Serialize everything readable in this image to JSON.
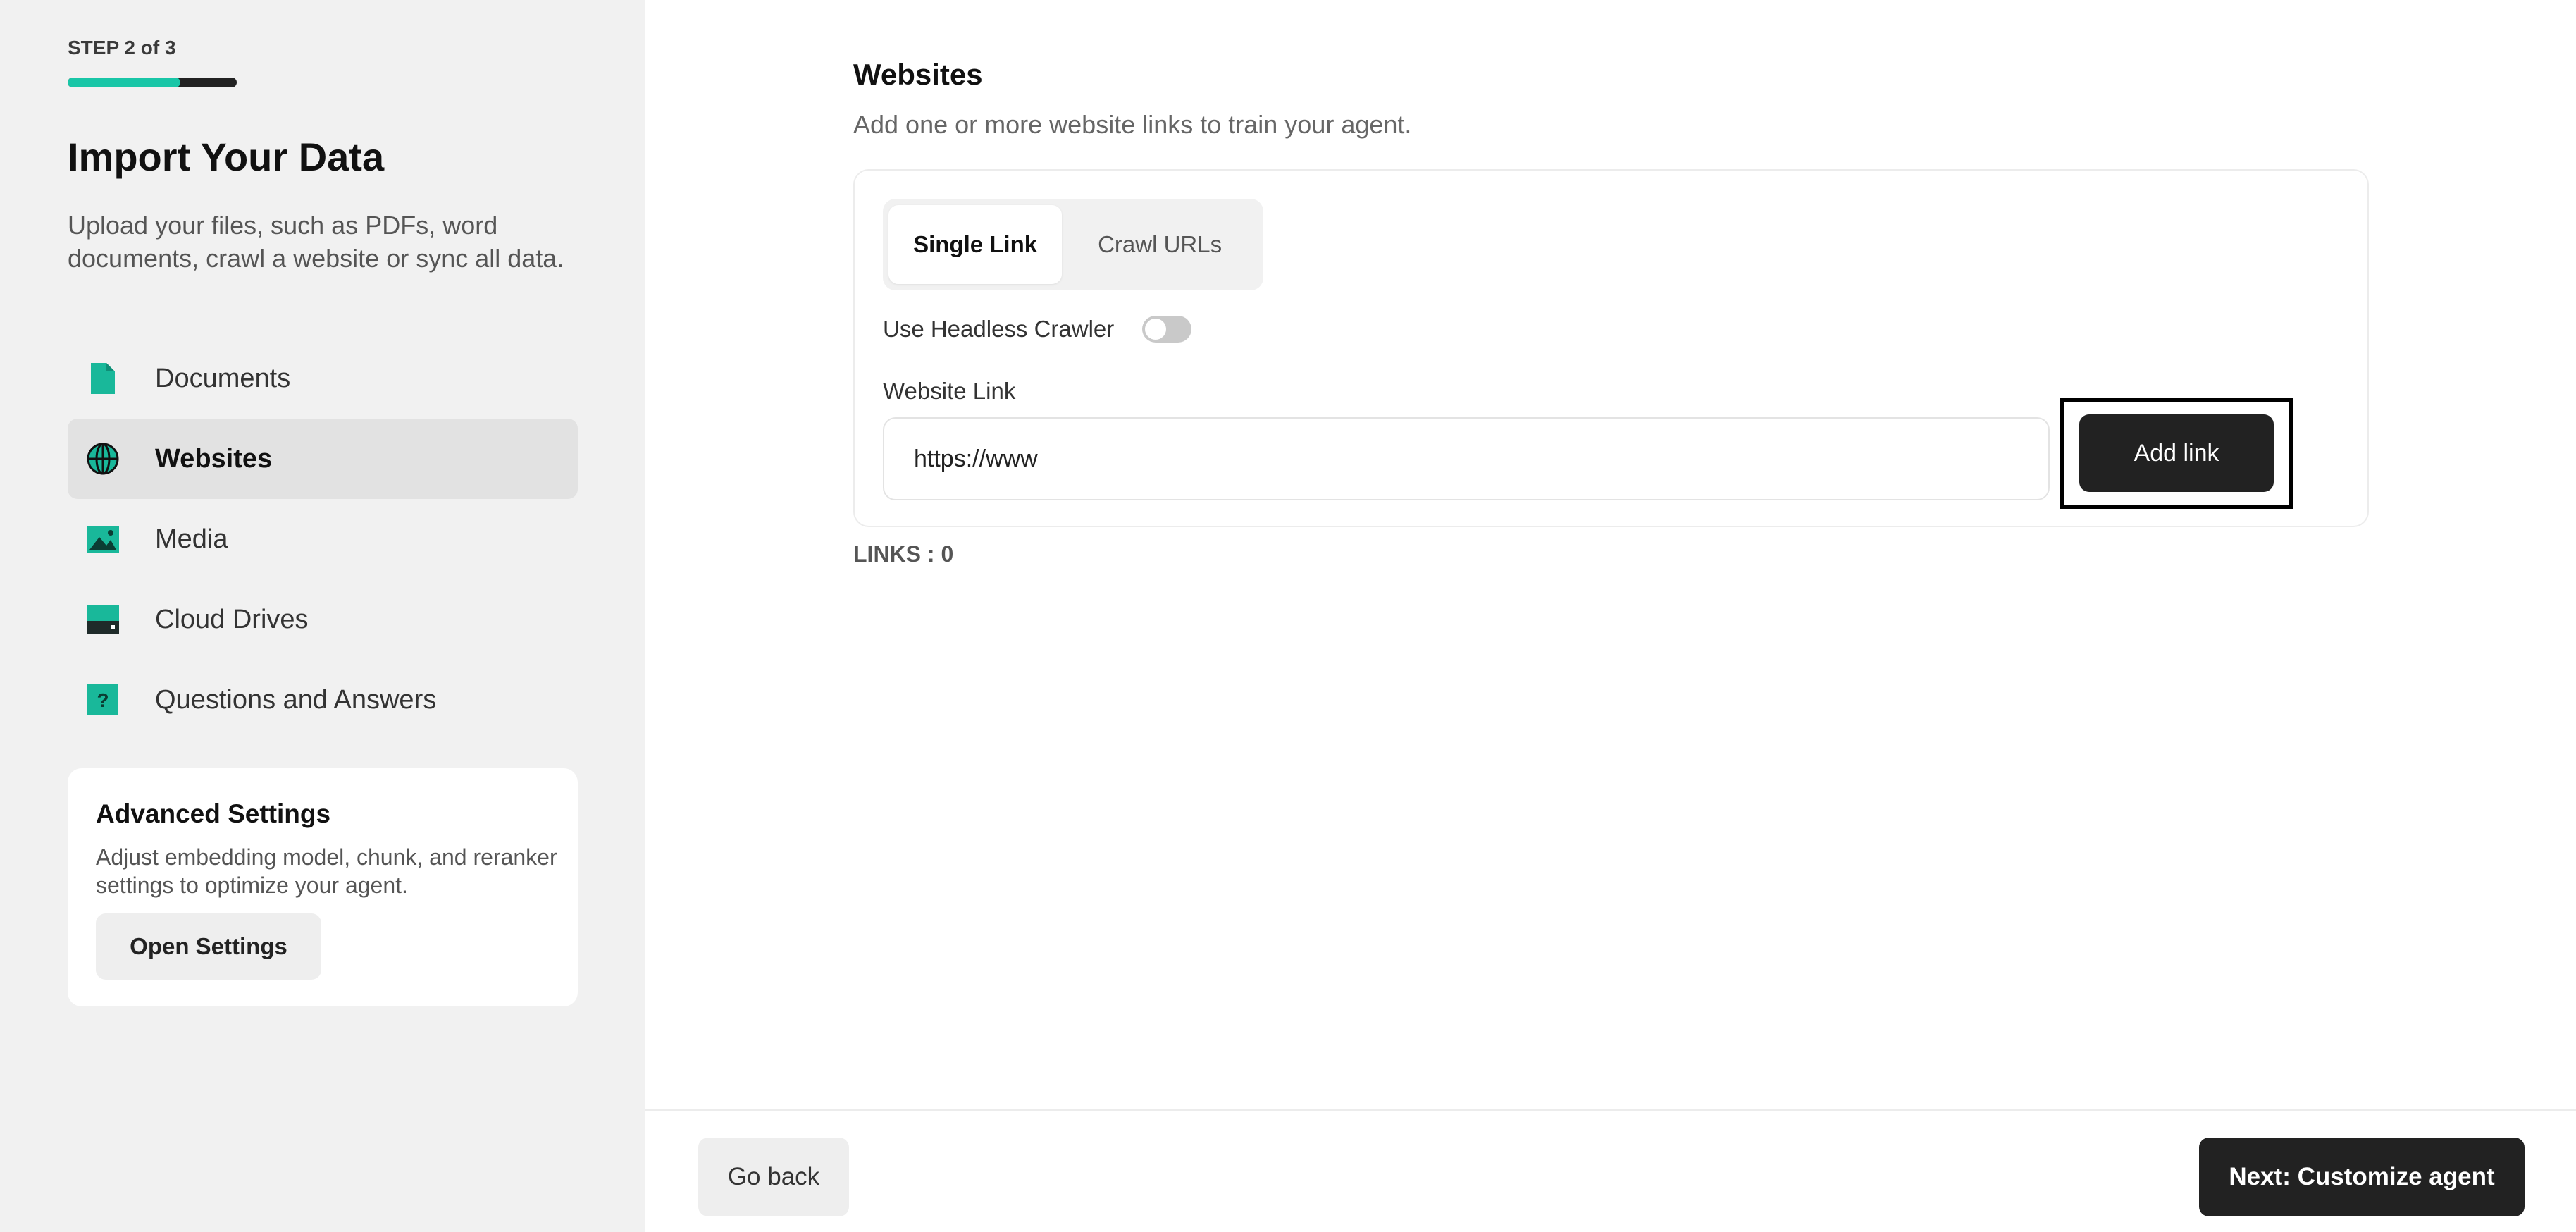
{
  "sidebar": {
    "step_label": "STEP 2 of 3",
    "progress_fraction": 0.667,
    "title": "Import Your Data",
    "description": "Upload your files, such as PDFs, word documents, crawl a website or sync all data.",
    "items": [
      {
        "label": "Documents",
        "icon": "document-icon"
      },
      {
        "label": "Websites",
        "icon": "globe-icon"
      },
      {
        "label": "Media",
        "icon": "image-icon"
      },
      {
        "label": "Cloud Drives",
        "icon": "drive-icon"
      },
      {
        "label": "Questions and Answers",
        "icon": "question-icon"
      }
    ],
    "active_item": "Websites",
    "advanced": {
      "title": "Advanced Settings",
      "description": "Adjust embedding model, chunk, and reranker settings to optimize your agent.",
      "button_label": "Open Settings"
    }
  },
  "main": {
    "title": "Websites",
    "description": "Add one or more website links to train your agent.",
    "tabs": [
      {
        "label": "Single Link",
        "active": true
      },
      {
        "label": "Crawl URLs",
        "active": false
      }
    ],
    "headless_label": "Use Headless Crawler",
    "headless_enabled": false,
    "link_field_label": "Website Link",
    "link_placeholder": "https://www",
    "add_button_label": "Add link",
    "links_count_label": "LINKS : 0"
  },
  "footer": {
    "back_label": "Go back",
    "next_label": "Next: Customize agent"
  },
  "colors": {
    "accent": "#19c6a7",
    "dark_button": "#222222",
    "sidebar_bg": "#f1f1f1"
  }
}
